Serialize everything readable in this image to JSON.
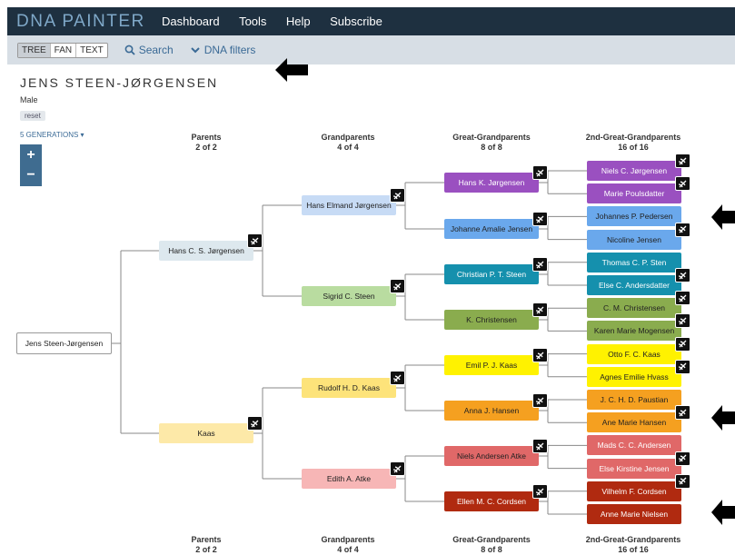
{
  "header": {
    "brand": "DNA PAINTER",
    "nav": [
      "Dashboard",
      "Tools",
      "Help",
      "Subscribe"
    ]
  },
  "subbar": {
    "views": [
      "TREE",
      "FAN",
      "TEXT"
    ],
    "search": "Search",
    "filters": "DNA filters"
  },
  "person": {
    "name": "JENS STEEN-JØRGENSEN",
    "gender": "Male",
    "reset": "reset",
    "generations": "5 GENERATIONS"
  },
  "zoom": {
    "plus": "+",
    "minus": "−"
  },
  "columns": [
    {
      "title": "Parents",
      "count": "2 of 2"
    },
    {
      "title": "Grandparents",
      "count": "4 of 4"
    },
    {
      "title": "Great-Grandparents",
      "count": "8 of 8"
    },
    {
      "title": "2nd-Great-Grandparents",
      "count": "16 of 16"
    }
  ],
  "tree": {
    "root": "Jens Steen-Jørgensen",
    "parents": [
      "Hans C. S. Jørgensen",
      "Kaas"
    ],
    "grandparents": [
      "Hans Elmand Jørgensen",
      "Sigrid C. Steen",
      "Rudolf H. D. Kaas",
      "Edith A. Atke"
    ],
    "great_grandparents": [
      "Hans K. Jørgensen",
      "Johanne Amalie Jensen",
      "Christian P. T. Steen",
      "K. Christensen",
      "Emil P. J. Kaas",
      "Anna J. Hansen",
      "Niels Andersen Atke",
      "Ellen M. C. Cordsen"
    ],
    "second_great_grandparents": [
      "Niels C. Jørgensen",
      "Marie Poulsdatter",
      "Johannes P. Pedersen",
      "Nicoline Jensen",
      "Thomas C. P. Sten",
      "Else C. Andersdatter",
      "C. M. Christensen",
      "Karen Marie Mogensen",
      "Otto F. C. Kaas",
      "Agnes Emilie Hvass",
      "J. C. H. D. Paustian",
      "Ane Marie Hansen",
      "Mads C. C. Andersen",
      "Else Kirstine Jensen",
      "Vilhelm F. Cordsen",
      "Anne Marie Nielsen"
    ]
  },
  "colors": {
    "topbar": "#1e3040",
    "purple": "#9a50c0",
    "blue": "#6aa8ec",
    "teal": "#1590ad",
    "green": "#8aac4e",
    "yellow": "#fff200",
    "orange": "#f5a020",
    "red": "#e06868",
    "darkred": "#b02a10"
  }
}
